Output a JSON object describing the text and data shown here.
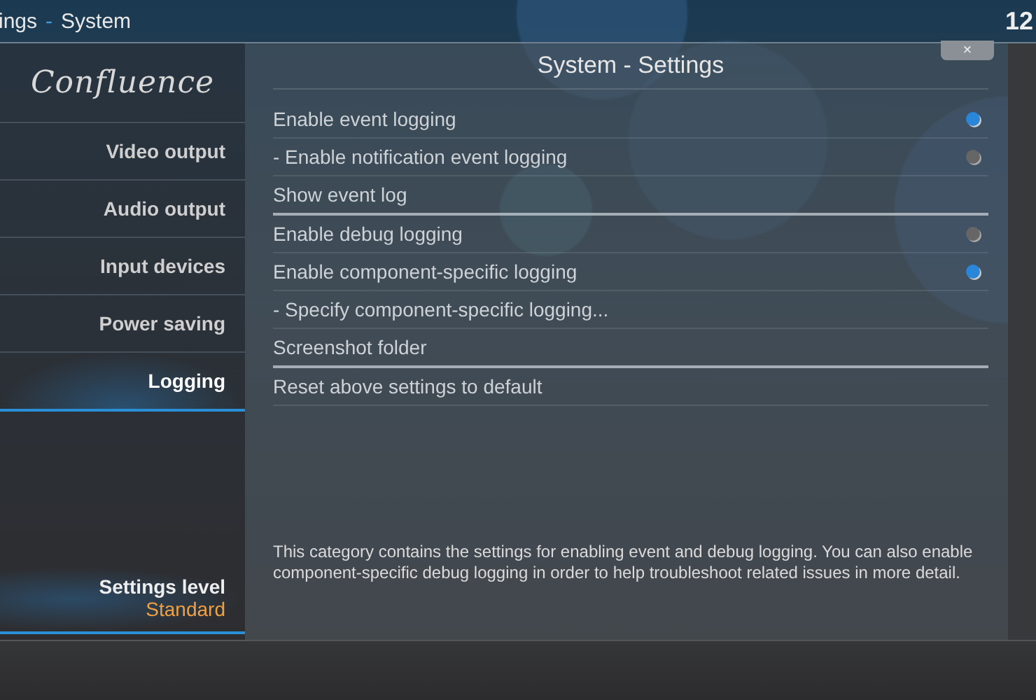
{
  "header": {
    "breadcrumb": {
      "parent": "ings",
      "separator": "-",
      "current": "System"
    },
    "clock": "12"
  },
  "sidebar": {
    "logo": "Confluence",
    "items": [
      {
        "label": "Video output",
        "selected": false
      },
      {
        "label": "Audio output",
        "selected": false
      },
      {
        "label": "Input devices",
        "selected": false
      },
      {
        "label": "Power saving",
        "selected": false
      },
      {
        "label": "Logging",
        "selected": true
      }
    ],
    "settings_level": {
      "label": "Settings level",
      "value": "Standard"
    }
  },
  "panel": {
    "title": "System - Settings",
    "close": "×",
    "rows": [
      {
        "label": "Enable event logging",
        "kind": "toggle",
        "on": true,
        "divider_after": false
      },
      {
        "label": "- Enable notification event logging",
        "kind": "toggle",
        "on": false,
        "divider_after": false
      },
      {
        "label": "Show event log",
        "kind": "action",
        "divider_after": true
      },
      {
        "label": "Enable debug logging",
        "kind": "toggle",
        "on": false,
        "divider_after": false
      },
      {
        "label": "Enable component-specific logging",
        "kind": "toggle",
        "on": true,
        "divider_after": false
      },
      {
        "label": "- Specify component-specific logging...",
        "kind": "action",
        "divider_after": false
      },
      {
        "label": "Screenshot folder",
        "kind": "action",
        "divider_after": true
      },
      {
        "label": "Reset above settings to default",
        "kind": "action",
        "divider_after": false
      }
    ],
    "description": "This category contains the settings for enabling event and debug logging. You can also enable component-specific debug logging in order to help troubleshoot related issues in more detail."
  }
}
